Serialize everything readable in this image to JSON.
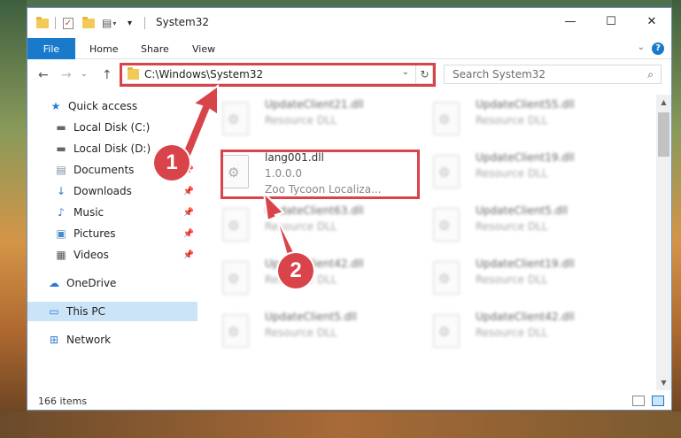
{
  "window": {
    "title": "System32",
    "controls": {
      "minimize": "—",
      "maximize": "☐",
      "close": "✕"
    }
  },
  "ribbon": {
    "file_tab": "File",
    "tabs": [
      "Home",
      "Share",
      "View"
    ],
    "collapse_glyph": "⌄",
    "help_glyph": "?"
  },
  "address": {
    "path": "C:\\Windows\\System32",
    "search_placeholder": "Search System32"
  },
  "sidebar": {
    "items": [
      {
        "label": "Quick access",
        "icon": "star-icon",
        "glyph": "★",
        "color": "#2b7bd6",
        "pinned": false
      },
      {
        "label": "Local Disk (C:)",
        "icon": "drive-icon",
        "glyph": "▬",
        "color": "#666",
        "pinned": false
      },
      {
        "label": "Local Disk (D:)",
        "icon": "drive-icon",
        "glyph": "▬",
        "color": "#666",
        "pinned": true
      },
      {
        "label": "Documents",
        "icon": "documents-icon",
        "glyph": "▤",
        "color": "#7a8aa0",
        "pinned": true
      },
      {
        "label": "Downloads",
        "icon": "downloads-icon",
        "glyph": "↓",
        "color": "#2b7bd6",
        "pinned": true
      },
      {
        "label": "Music",
        "icon": "music-icon",
        "glyph": "♪",
        "color": "#2b7bd6",
        "pinned": true
      },
      {
        "label": "Pictures",
        "icon": "pictures-icon",
        "glyph": "▣",
        "color": "#4a8ac6",
        "pinned": true
      },
      {
        "label": "Videos",
        "icon": "videos-icon",
        "glyph": "▦",
        "color": "#555",
        "pinned": true
      },
      {
        "label": "OneDrive",
        "icon": "cloud-icon",
        "glyph": "☁",
        "color": "#2b7bd6",
        "pinned": false
      },
      {
        "label": "This PC",
        "icon": "computer-icon",
        "glyph": "▭",
        "color": "#2b7bd6",
        "pinned": false
      },
      {
        "label": "Network",
        "icon": "network-icon",
        "glyph": "⊞",
        "color": "#2b7bd6",
        "pinned": false
      }
    ]
  },
  "files": {
    "highlighted": {
      "name": "lang001.dll",
      "version": "1.0.0.0",
      "description": "Zoo Tycoon Localiza..."
    },
    "left_column": [
      {
        "name": "UpdateClient21.dll",
        "desc": "Resource DLL"
      },
      {
        "name": "UpdateClient63.dll",
        "desc": "Resource DLL"
      },
      {
        "name": "UpdateClient42.dll",
        "desc": "Resource DLL"
      },
      {
        "name": "UpdateClient5.dll",
        "desc": "Resource DLL"
      }
    ],
    "right_column": [
      {
        "name": "UpdateClient55.dll",
        "desc": "Resource DLL"
      },
      {
        "name": "UpdateClient19.dll",
        "desc": "Resource DLL"
      },
      {
        "name": "UpdateClient5.dll",
        "desc": "Resource DLL"
      },
      {
        "name": "UpdateClient19.dll",
        "desc": "Resource DLL"
      },
      {
        "name": "UpdateClient42.dll",
        "desc": "Resource DLL"
      }
    ]
  },
  "status": {
    "item_count": "166 items"
  },
  "callouts": {
    "one": "1",
    "two": "2"
  },
  "colors": {
    "accent": "#1979ca",
    "annotation": "#d9434a",
    "selection": "#cce4f7"
  }
}
